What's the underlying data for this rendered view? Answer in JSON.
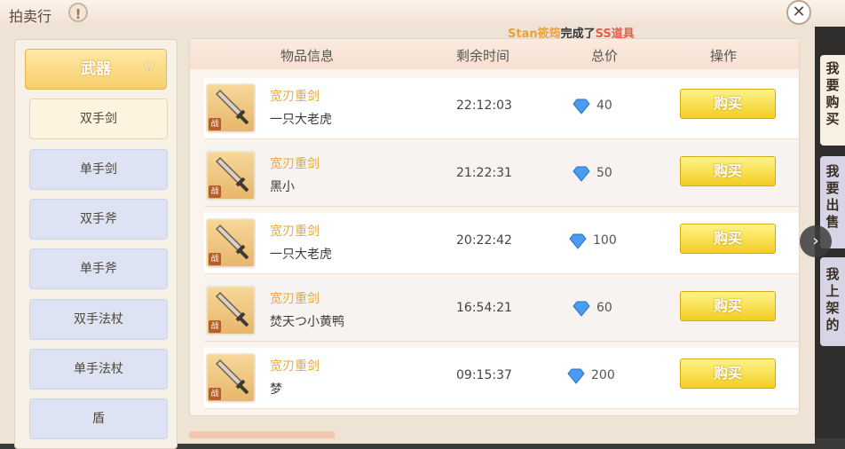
{
  "window": {
    "title": "拍卖行",
    "close_label": "✕"
  },
  "announcement": {
    "player": "Stan筱筠",
    "action": "完成了",
    "item": "SS道具"
  },
  "sidebar": {
    "category": "武器",
    "subcategories": [
      "双手剑",
      "单手剑",
      "双手斧",
      "单手斧",
      "双手法杖",
      "单手法杖",
      "盾"
    ]
  },
  "table": {
    "headers": {
      "item": "物品信息",
      "time": "剩余时间",
      "price": "总价",
      "action": "操作"
    },
    "rows": [
      {
        "item": "宽刃重剑",
        "seller": "一只大老虎",
        "time": "22:12:03",
        "price": "40",
        "buy": "购买",
        "badge": "战"
      },
      {
        "item": "宽刃重剑",
        "seller": "黑小",
        "time": "21:22:31",
        "price": "50",
        "buy": "购买",
        "badge": "战"
      },
      {
        "item": "宽刃重剑",
        "seller": "一只大老虎",
        "time": "20:22:42",
        "price": "100",
        "buy": "购买",
        "badge": "战"
      },
      {
        "item": "宽刃重剑",
        "seller": "焚天つ小黄鸭",
        "time": "16:54:21",
        "price": "60",
        "buy": "购买",
        "badge": "战"
      },
      {
        "item": "宽刃重剑",
        "seller": "梦",
        "time": "09:15:37",
        "price": "200",
        "buy": "购买",
        "badge": "战"
      }
    ]
  },
  "tabs": [
    "我要购买",
    "我要出售",
    "我上架的"
  ],
  "colors": {
    "buy_button": "#f2cd22",
    "item_name": "#e8a83a",
    "gem": "#4a9cf0"
  }
}
